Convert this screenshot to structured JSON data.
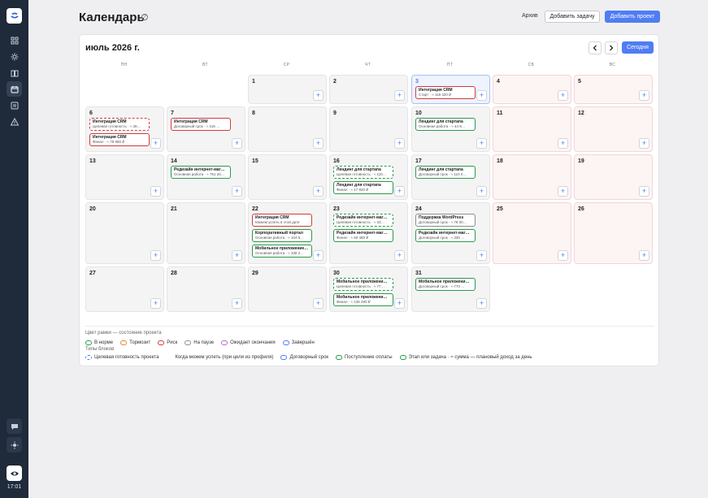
{
  "header": {
    "title": "Календарь",
    "help": "?",
    "archive_label": "Архив",
    "add_task_label": "Добавить задачу",
    "add_project_label": "Добавить проект"
  },
  "sidebar": {
    "time": "17:01",
    "items": [
      "dashboard-icon",
      "sun-icon",
      "book-icon",
      "calendar-icon",
      "report-icon",
      "alert-icon"
    ],
    "active": "calendar-icon"
  },
  "calendar": {
    "month_title": "июль 2026 г.",
    "today_label": "Сегодня",
    "add_symbol": "+",
    "weekdays": [
      "ПН",
      "ВТ",
      "СР",
      "ЧТ",
      "ПТ",
      "СБ",
      "ВС"
    ],
    "weeks": [
      [
        null,
        null,
        {
          "num": "1",
          "events": []
        },
        {
          "num": "2",
          "events": []
        },
        {
          "num": "3",
          "today": true,
          "events": [
            {
              "title": "Интеграция CRM",
              "sub": "Старт · ≈ 118 320 ₽",
              "style": "risk"
            }
          ]
        },
        {
          "num": "4",
          "weekend": true,
          "events": []
        },
        {
          "num": "5",
          "weekend": true,
          "events": []
        }
      ],
      [
        {
          "num": "6",
          "events": [
            {
              "title": "Интеграция CRM",
              "sub": "Целевая готовность · ≈ 39…",
              "style": "risk dashed"
            },
            {
              "title": "Интеграция CRM",
              "sub": "Финал · ≈ 78 880 ₽",
              "style": "risk"
            }
          ]
        },
        {
          "num": "7",
          "events": [
            {
              "title": "Интеграция CRM",
              "sub": "Договорный срок · ≈ 315 …",
              "style": "risk"
            }
          ]
        },
        {
          "num": "8",
          "events": []
        },
        {
          "num": "9",
          "events": []
        },
        {
          "num": "10",
          "events": [
            {
              "title": "Лендинг для стартапа",
              "sub": "Основная работа · ≈ 44 8…",
              "style": ""
            }
          ]
        },
        {
          "num": "11",
          "weekend": true,
          "events": []
        },
        {
          "num": "12",
          "weekend": true,
          "events": []
        }
      ],
      [
        {
          "num": "13",
          "events": []
        },
        {
          "num": "14",
          "events": [
            {
              "title": "Редизайн интернет-маг…",
              "sub": "Основная работа · ≈ 761 20…",
              "style": ""
            }
          ]
        },
        {
          "num": "15",
          "events": []
        },
        {
          "num": "16",
          "events": [
            {
              "title": "Лендинг для стартапа",
              "sub": "Целевая готовность · ≈ 110…",
              "style": "dashed"
            },
            {
              "title": "Лендинг для стартапа",
              "sub": "Финал · ≈ 17 920 ₽",
              "style": ""
            }
          ]
        },
        {
          "num": "17",
          "events": [
            {
              "title": "Лендинг для стартапа",
              "sub": "Договорный срок · ≈ 110 0…",
              "style": ""
            }
          ]
        },
        {
          "num": "18",
          "weekend": true,
          "events": []
        },
        {
          "num": "19",
          "weekend": true,
          "events": []
        }
      ],
      [
        {
          "num": "20",
          "events": []
        },
        {
          "num": "21",
          "events": []
        },
        {
          "num": "22",
          "events": [
            {
              "title": "Интеграция CRM",
              "sub": "Можем успеть в этой дате",
              "style": "risk"
            },
            {
              "title": "Корпоративный портал",
              "sub": "Основная работа · ≈ 104 5…",
              "style": ""
            },
            {
              "title": "Мобильное приложение…",
              "sub": "Основная работа · ≈ 338 2…",
              "style": ""
            }
          ]
        },
        {
          "num": "23",
          "events": [
            {
              "title": "Редизайн интернет-маг…",
              "sub": "Целевая готовность · ≈ 33…",
              "style": "dashed"
            },
            {
              "title": "Редизайн интернет-маг…",
              "sub": "Финал · ≈ 60 480 ₽",
              "style": ""
            }
          ]
        },
        {
          "num": "24",
          "events": [
            {
              "title": "Поддержка WordPress",
              "sub": "Договорный срок · ≈ 78 00…",
              "style": "gray"
            },
            {
              "title": "Редизайн интернет-маг…",
              "sub": "Договорный срок · ≈ 330 …",
              "style": ""
            }
          ]
        },
        {
          "num": "25",
          "weekend": true,
          "events": []
        },
        {
          "num": "26",
          "weekend": true,
          "events": []
        }
      ],
      [
        {
          "num": "27",
          "events": []
        },
        {
          "num": "28",
          "events": []
        },
        {
          "num": "29",
          "events": []
        },
        {
          "num": "30",
          "events": [
            {
              "title": "Мобильное приложени…",
              "sub": "Целевая готовность · ≈ 77…",
              "style": "dashed"
            },
            {
              "title": "Мобильное приложени…",
              "sub": "Финал · ≈ 135 280 ₽",
              "style": ""
            }
          ]
        },
        {
          "num": "31",
          "events": [
            {
              "title": "Мобильное приложени…",
              "sub": "Договорный срок · ≈ 770 …",
              "style": ""
            }
          ]
        },
        null,
        null
      ]
    ]
  },
  "legend": {
    "frame_title": "Цвет рамки — состояние проекта",
    "states": [
      {
        "label": "В норме",
        "color": "#2a9a49"
      },
      {
        "label": "Тормозит",
        "color": "#e08a2c"
      },
      {
        "label": "Риск",
        "color": "#d23b3b"
      },
      {
        "label": "На паузе",
        "color": "#8a8f96"
      },
      {
        "label": "Ожидает окончания",
        "color": "#b06fd0"
      },
      {
        "label": "Завершён",
        "color": "#4f7df3"
      }
    ],
    "types_title": "Типы блоков",
    "types": [
      {
        "label": "Целевая готовность проекта",
        "color": "#4f7df3",
        "dashed": true
      },
      {
        "label": "Когда можем успеть (при цели из профиля)",
        "color": "#ffffff",
        "dashed": false
      },
      {
        "label": "Договорный срок",
        "color": "#4f7df3",
        "dashed": false
      },
      {
        "label": "Поступление оплаты",
        "color": "#2a9a49",
        "dashed": false
      },
      {
        "label": "Этап или задача · ≈ сумма — плановый доход за день",
        "color": "#2a9a49",
        "dashed": false
      }
    ]
  }
}
